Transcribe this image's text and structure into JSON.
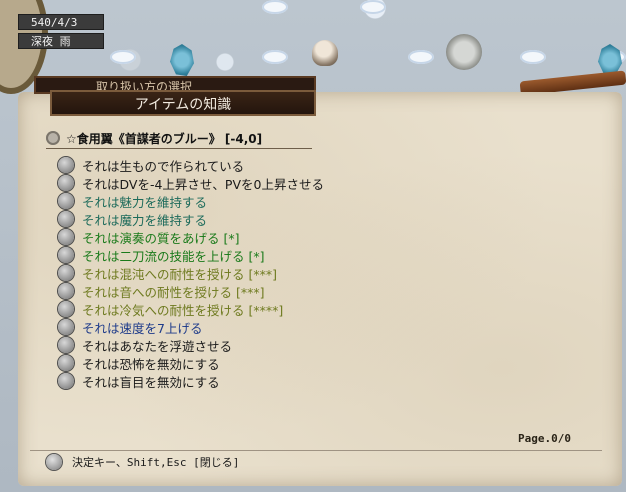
{
  "status": {
    "date": "540/4/3",
    "weather": "深夜 雨"
  },
  "window": {
    "back_tab": "取り扱い方の選択",
    "title": "アイテムの知識"
  },
  "item": {
    "name": "☆食用翼《首謀者のブルー》 [-4,0]"
  },
  "effects": [
    {
      "text": "それは生もので作られている",
      "color": "#1a1a1a",
      "icon": "shield-icon"
    },
    {
      "text": "それはDVを-4上昇させ、PVを0上昇させる",
      "color": "#1a1a1a",
      "icon": "armor-icon"
    },
    {
      "text": "それは魅力を維持する",
      "color": "#1d6b5b",
      "icon": "bell-icon"
    },
    {
      "text": "それは魔力を維持する",
      "color": "#1d6b5b",
      "icon": "bell-icon"
    },
    {
      "text": "それは演奏の質をあげる [*]",
      "color": "#1a7a1a",
      "icon": "music-icon"
    },
    {
      "text": "それは二刀流の技能を上げる [*]",
      "color": "#1a7a1a",
      "icon": "sword-icon"
    },
    {
      "text": "それは混沌への耐性を授ける [***]",
      "color": "#6e7a1f",
      "icon": "orb-icon"
    },
    {
      "text": "それは音への耐性を授ける [***]",
      "color": "#6e7a1f",
      "icon": "orb-icon"
    },
    {
      "text": "それは冷気への耐性を授ける [****]",
      "color": "#6e7a1f",
      "icon": "orb-icon"
    },
    {
      "text": "それは速度を7上げる",
      "color": "#1e3b8a",
      "icon": "speed-icon"
    },
    {
      "text": "それはあなたを浮遊させる",
      "color": "#1a1a1a",
      "icon": "feather-icon"
    },
    {
      "text": "それは恐怖を無効にする",
      "color": "#1a1a1a",
      "icon": "feather-icon"
    },
    {
      "text": "それは盲目を無効にする",
      "color": "#1a1a1a",
      "icon": "feather-icon"
    }
  ],
  "footer": {
    "page": "Page.0/0",
    "hint": "決定キー、Shift,Esc [閉じる]"
  }
}
